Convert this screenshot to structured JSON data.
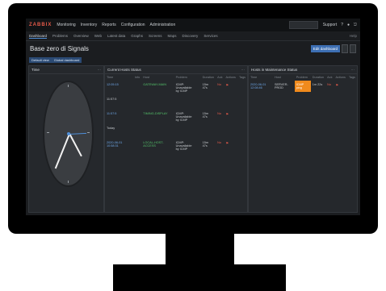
{
  "topbar": {
    "logo": "ZABBIX",
    "menu": [
      "Monitoring",
      "Inventory",
      "Reports",
      "Configuration",
      "Administration"
    ],
    "user": "Support",
    "icons": [
      "help-icon",
      "user-icon",
      "logout-icon"
    ]
  },
  "subnav": {
    "items": [
      "Dashboard",
      "Problems",
      "Overview",
      "Web",
      "Latest data",
      "Graphs",
      "Screens",
      "Maps",
      "Discovery",
      "Services"
    ],
    "active_index": 0,
    "right": "Help"
  },
  "page": {
    "title": "Base zero di Signals",
    "edit_label": "Edit dashboard"
  },
  "dashboard_tabs": [
    "Default view",
    "Global dashboard"
  ],
  "widgets": {
    "time": {
      "title": "Time"
    },
    "problems": {
      "title": "Current Hosts Status",
      "columns": [
        "Time",
        "Info",
        "Host",
        "Problem",
        "Duration",
        "Ack",
        "Actions",
        "Tags"
      ],
      "rows": [
        {
          "time": "12:05:15",
          "host": "GATEWAY-MAIN",
          "problem": "ICMP: Unavailable",
          "problem2": "by ICMP",
          "duration": "15m 47s",
          "ack": "No"
        },
        {
          "time": "11:57:5",
          "host": "",
          "problem": "",
          "problem2": "",
          "duration": "",
          "ack": ""
        },
        {
          "time": "11:57:5",
          "host": "TIMING-DISPLAY",
          "problem": "ICMP: Unavailable",
          "problem2": "by ICMP",
          "duration": "15m 47s",
          "ack": "No"
        },
        {
          "time": "Today",
          "host": "",
          "problem": "",
          "problem2": "",
          "duration": "",
          "ack": ""
        },
        {
          "time": "2020-06-01 10:58:31",
          "host": "LOCAL-HOST-ACCESS",
          "problem": "ICMP: Unavailable",
          "problem2": "by ICMP",
          "duration": "15m 47s",
          "ack": "No"
        }
      ]
    },
    "maintenance": {
      "title": "Hosts in Maintenance Status",
      "columns": [
        "Time",
        "Host",
        "Problem",
        "Duration",
        "Ack",
        "Actions",
        "Tags"
      ],
      "rows": [
        {
          "time": "2020-06-01 12:08:46",
          "host": "SERVER-PROD",
          "problem": "ICMP ping",
          "duration": "1m 22s",
          "ack": "No"
        }
      ]
    }
  }
}
